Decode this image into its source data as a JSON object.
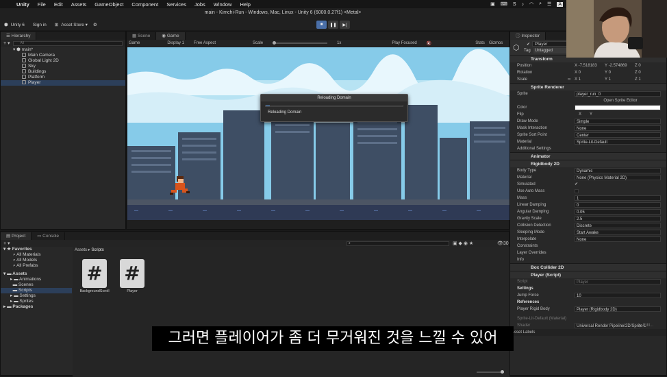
{
  "menubar": {
    "apple": "",
    "app": "Unity",
    "items": [
      "File",
      "Edit",
      "Assets",
      "GameObject",
      "Component",
      "Services",
      "Jobs",
      "Window",
      "Help"
    ],
    "status_icons": [
      "S",
      "A"
    ]
  },
  "window": {
    "title": "main - Kimchi-Run - Windows, Mac, Linux - Unity 6 (6000.0.27f1) <Metal>"
  },
  "toolbar": {
    "unity": "Unity 6",
    "signin": "Sign in",
    "asset_store": "Asset Store ▾"
  },
  "hierarchy": {
    "tab": "Hierarchy",
    "search_placeholder": "All",
    "scene": "main*",
    "items": [
      "Main Camera",
      "Global Light 2D",
      "Sky",
      "Buildings",
      "Platform",
      "Player"
    ]
  },
  "game": {
    "tabs": [
      "Scene",
      "Game"
    ],
    "bar": {
      "mode": "Game",
      "display": "Display 1",
      "aspect": "Free Aspect",
      "scale_label": "Scale",
      "scale_value": "1x",
      "play_focused": "Play Focused",
      "stats": "Stats",
      "gizmos": "Gizmos"
    }
  },
  "dialog": {
    "title": "Reloading Domain",
    "message": "Reloading Domain",
    "progress": 0.03
  },
  "inspector": {
    "tab": "Inspector",
    "object": "Player",
    "tag_label": "Tag",
    "tag": "Untagged",
    "transform": {
      "title": "Transform",
      "position_label": "Position",
      "position": [
        "-7.518183",
        "-2.574869",
        "0"
      ],
      "rotation_label": "Rotation",
      "rotation": [
        "0",
        "0",
        "0"
      ],
      "scale_label": "Scale",
      "scale": [
        "1",
        "1",
        "1"
      ]
    },
    "sprite_renderer": {
      "title": "Sprite Renderer",
      "sprite_label": "Sprite",
      "sprite": "player_run_0",
      "open_editor": "Open Sprite Editor",
      "color_label": "Color",
      "flip_label": "Flip",
      "flip_x": "X",
      "flip_y": "Y",
      "draw_mode_label": "Draw Mode",
      "draw_mode": "Simple",
      "mask_label": "Mask Interaction",
      "mask": "None",
      "sort_label": "Sprite Sort Point",
      "sort": "Center",
      "material_label": "Material",
      "material": "Sprite-Lit-Default",
      "additional": "Additional Settings"
    },
    "animator": {
      "title": "Animator"
    },
    "rigidbody": {
      "title": "Rigidbody 2D",
      "body_type_label": "Body Type",
      "body_type": "Dynamic",
      "material_label": "Material",
      "material": "None (Physics Material 2D)",
      "simulated_label": "Simulated",
      "auto_mass_label": "Use Auto Mass",
      "mass_label": "Mass",
      "mass": "1",
      "linear_label": "Linear Damping",
      "linear": "0",
      "angular_label": "Angular Damping",
      "angular": "0.05",
      "gravity_label": "Gravity Scale",
      "gravity": "2.5",
      "collision_label": "Collision Detection",
      "collision": "Discrete",
      "sleep_label": "Sleeping Mode",
      "sleep": "Start Awake",
      "interp_label": "Interpolate",
      "interp": "None",
      "constraints": "Constraints",
      "layer_overrides": "Layer Overrides",
      "info": "Info"
    },
    "box_collider": {
      "title": "Box Collider 2D"
    },
    "player_script": {
      "title": "Player (Script)",
      "script_label": "Script",
      "script": "Player",
      "settings": "Settings",
      "jump_label": "Jump Force",
      "jump": "10",
      "references": "References",
      "rb_label": "Player Rigid Body",
      "rb": "Player (Rigidbody 2D)"
    },
    "material_footer": {
      "name": "Sprite-Lit-Default (Material)",
      "shader_label": "Shader",
      "shader": "Universal Render Pipeline/2D/Sprite-L",
      "edit": "Edit..."
    },
    "asset_labels": "Asset Labels"
  },
  "project": {
    "tabs": [
      "Project",
      "Console"
    ],
    "favorites": "Favorites",
    "fav_items": [
      "All Materials",
      "All Models",
      "All Prefabs"
    ],
    "assets": "Assets",
    "asset_folders": [
      "Animations",
      "Scenes",
      "Scripts",
      "Settings",
      "Sprites"
    ],
    "packages": "Packages",
    "breadcrumb": [
      "Assets",
      "Scripts"
    ],
    "count": "30",
    "files": [
      "BackgroundScroll",
      "Player"
    ]
  },
  "subtitle": "그러면 플레이어가 좀 더 무거워진 것을 느낄 수 있어"
}
